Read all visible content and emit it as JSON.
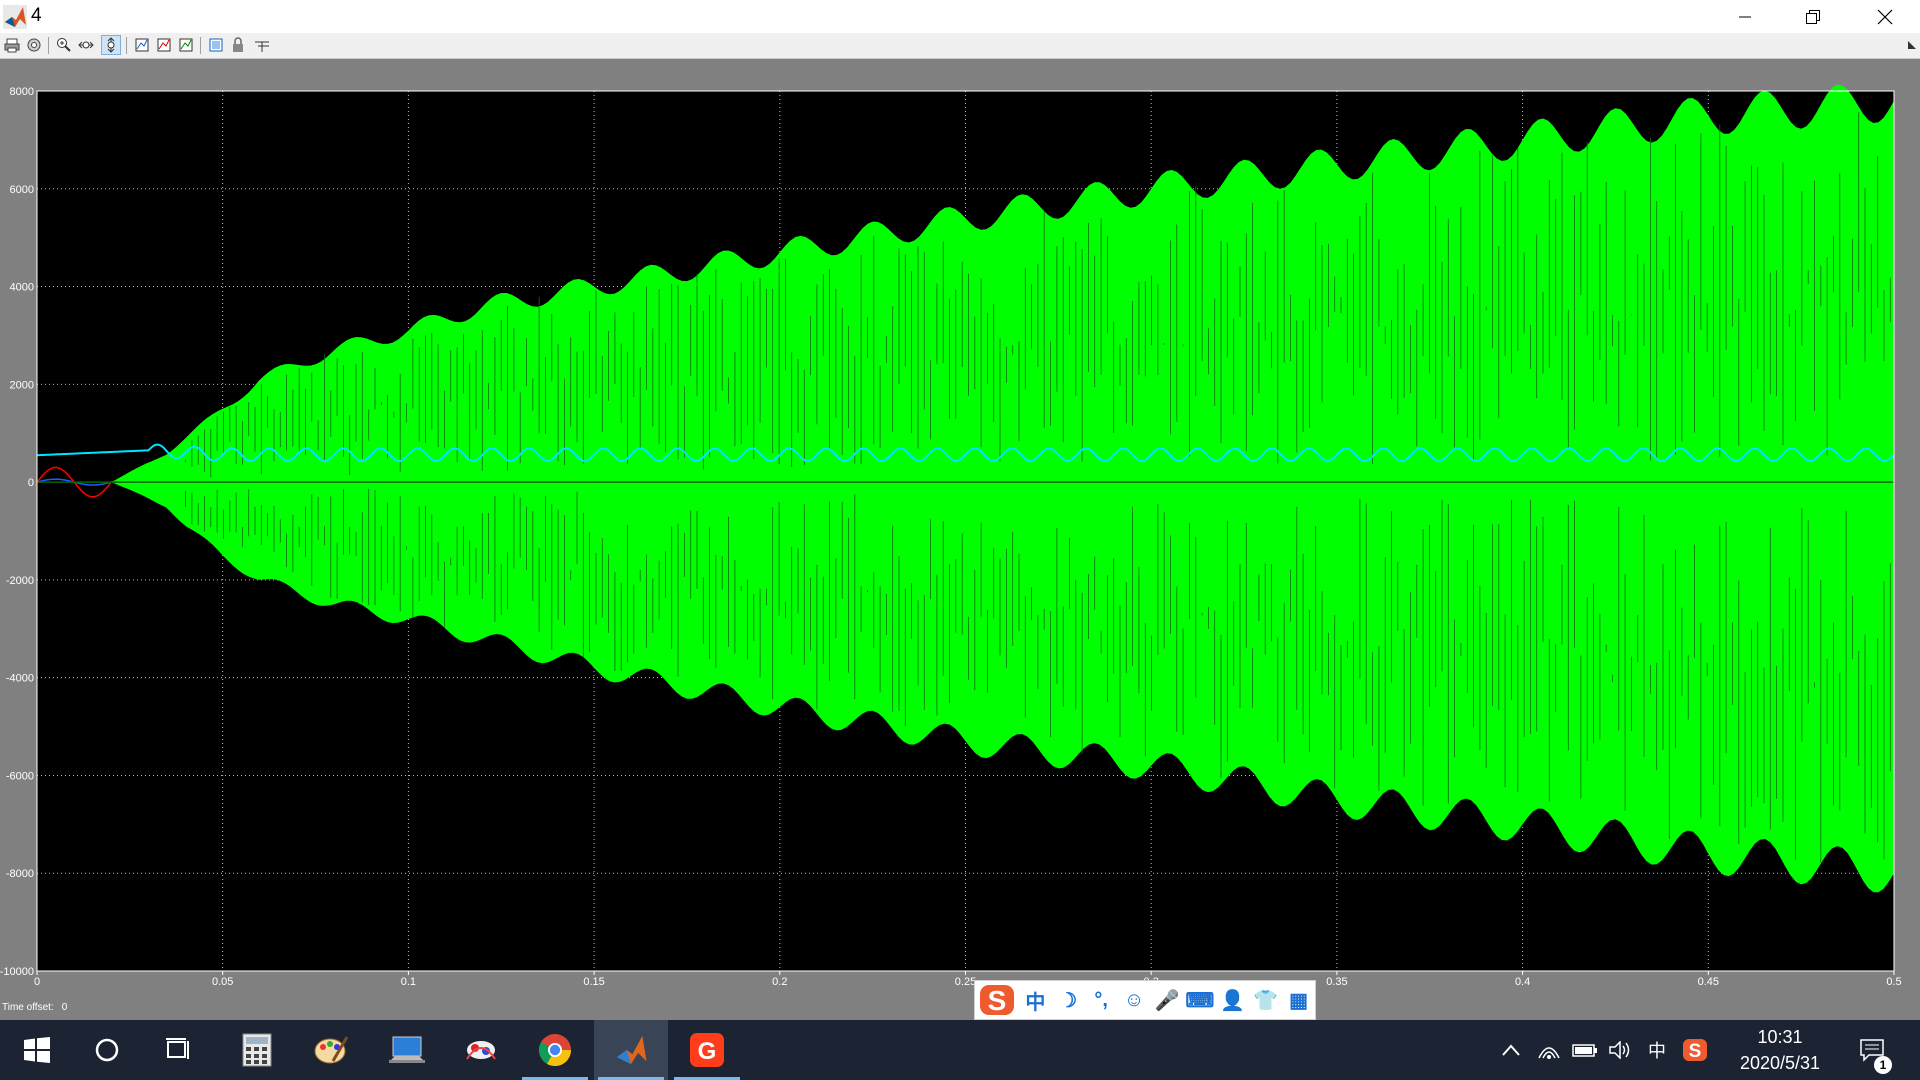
{
  "window": {
    "title": "4"
  },
  "toolbar": {
    "items": [
      "print-icon",
      "settings-icon",
      "zoom-in-icon",
      "zoom-x-icon",
      "zoom-y-icon",
      "autoscale-icon",
      "save-axes-icon",
      "restore-axes-icon",
      "float-icon",
      "lock-icon",
      "signal-select-icon"
    ],
    "active_item": "zoom-y-icon"
  },
  "chart_data": {
    "type": "line",
    "background": "#000000",
    "xlim": [
      0,
      0.5
    ],
    "ylim": [
      -10000,
      8000
    ],
    "x_ticks": [
      "0",
      "0.05",
      "0.1",
      "0.15",
      "0.2",
      "0.25",
      "0.3",
      "0.35",
      "0.4",
      "0.45",
      "0.5"
    ],
    "y_ticks": [
      "8000",
      "6000",
      "4000",
      "2000",
      "0",
      "-2000",
      "-4000",
      "-6000",
      "-8000",
      "-10000"
    ],
    "grid": true,
    "series": [
      {
        "color": "#00ff00",
        "style": "oscillating band",
        "x": [
          0,
          0.02,
          0.035,
          0.04,
          0.05,
          0.06,
          0.08,
          0.1,
          0.12,
          0.15,
          0.2,
          0.25,
          0.3,
          0.35,
          0.4,
          0.45,
          0.5
        ],
        "upper": [
          0,
          0,
          600,
          900,
          1500,
          2100,
          2700,
          3100,
          3600,
          4000,
          4700,
          5400,
          6000,
          6500,
          7000,
          7500,
          7800
        ],
        "lower": [
          0,
          0,
          -500,
          -900,
          -1500,
          -2000,
          -2500,
          -2800,
          -3200,
          -3800,
          -4600,
          -5300,
          -5800,
          -6500,
          -7000,
          -7600,
          -8000
        ]
      },
      {
        "color": "#00e5ff",
        "style": "ripple",
        "x": [
          0,
          0.03,
          0.05,
          0.1,
          0.2,
          0.3,
          0.4,
          0.5
        ],
        "y": [
          550,
          650,
          560,
          560,
          560,
          560,
          560,
          560
        ],
        "ripple_amplitude": 130
      },
      {
        "color": "#ff0000",
        "style": "sine",
        "x": [
          0,
          0.005,
          0.01,
          0.015,
          0.02
        ],
        "y": [
          0,
          270,
          0,
          -300,
          0
        ]
      },
      {
        "color": "#1e5bff",
        "style": "sine",
        "x": [
          0,
          0.005,
          0.01,
          0.015,
          0.02
        ],
        "y": [
          0,
          60,
          0,
          -60,
          0
        ]
      }
    ]
  },
  "footer": {
    "time_offset_label": "Time offset:",
    "time_offset_value": "0"
  },
  "ime": {
    "items": [
      "中",
      "☽",
      "°,",
      "☺",
      "🎤",
      "⌨",
      "👤",
      "👕",
      "▦"
    ]
  },
  "taskbar": {
    "apps": [
      "start-icon",
      "cortana-icon",
      "task-view-icon",
      "calculator-icon",
      "paint-icon",
      "computer-icon",
      "app-icon",
      "chrome-icon",
      "matlab-icon",
      "app-g-icon"
    ],
    "active_app": "matlab-icon",
    "tray_lang": "中",
    "time": "10:31",
    "date": "2020/5/31",
    "notification_count": "1"
  }
}
